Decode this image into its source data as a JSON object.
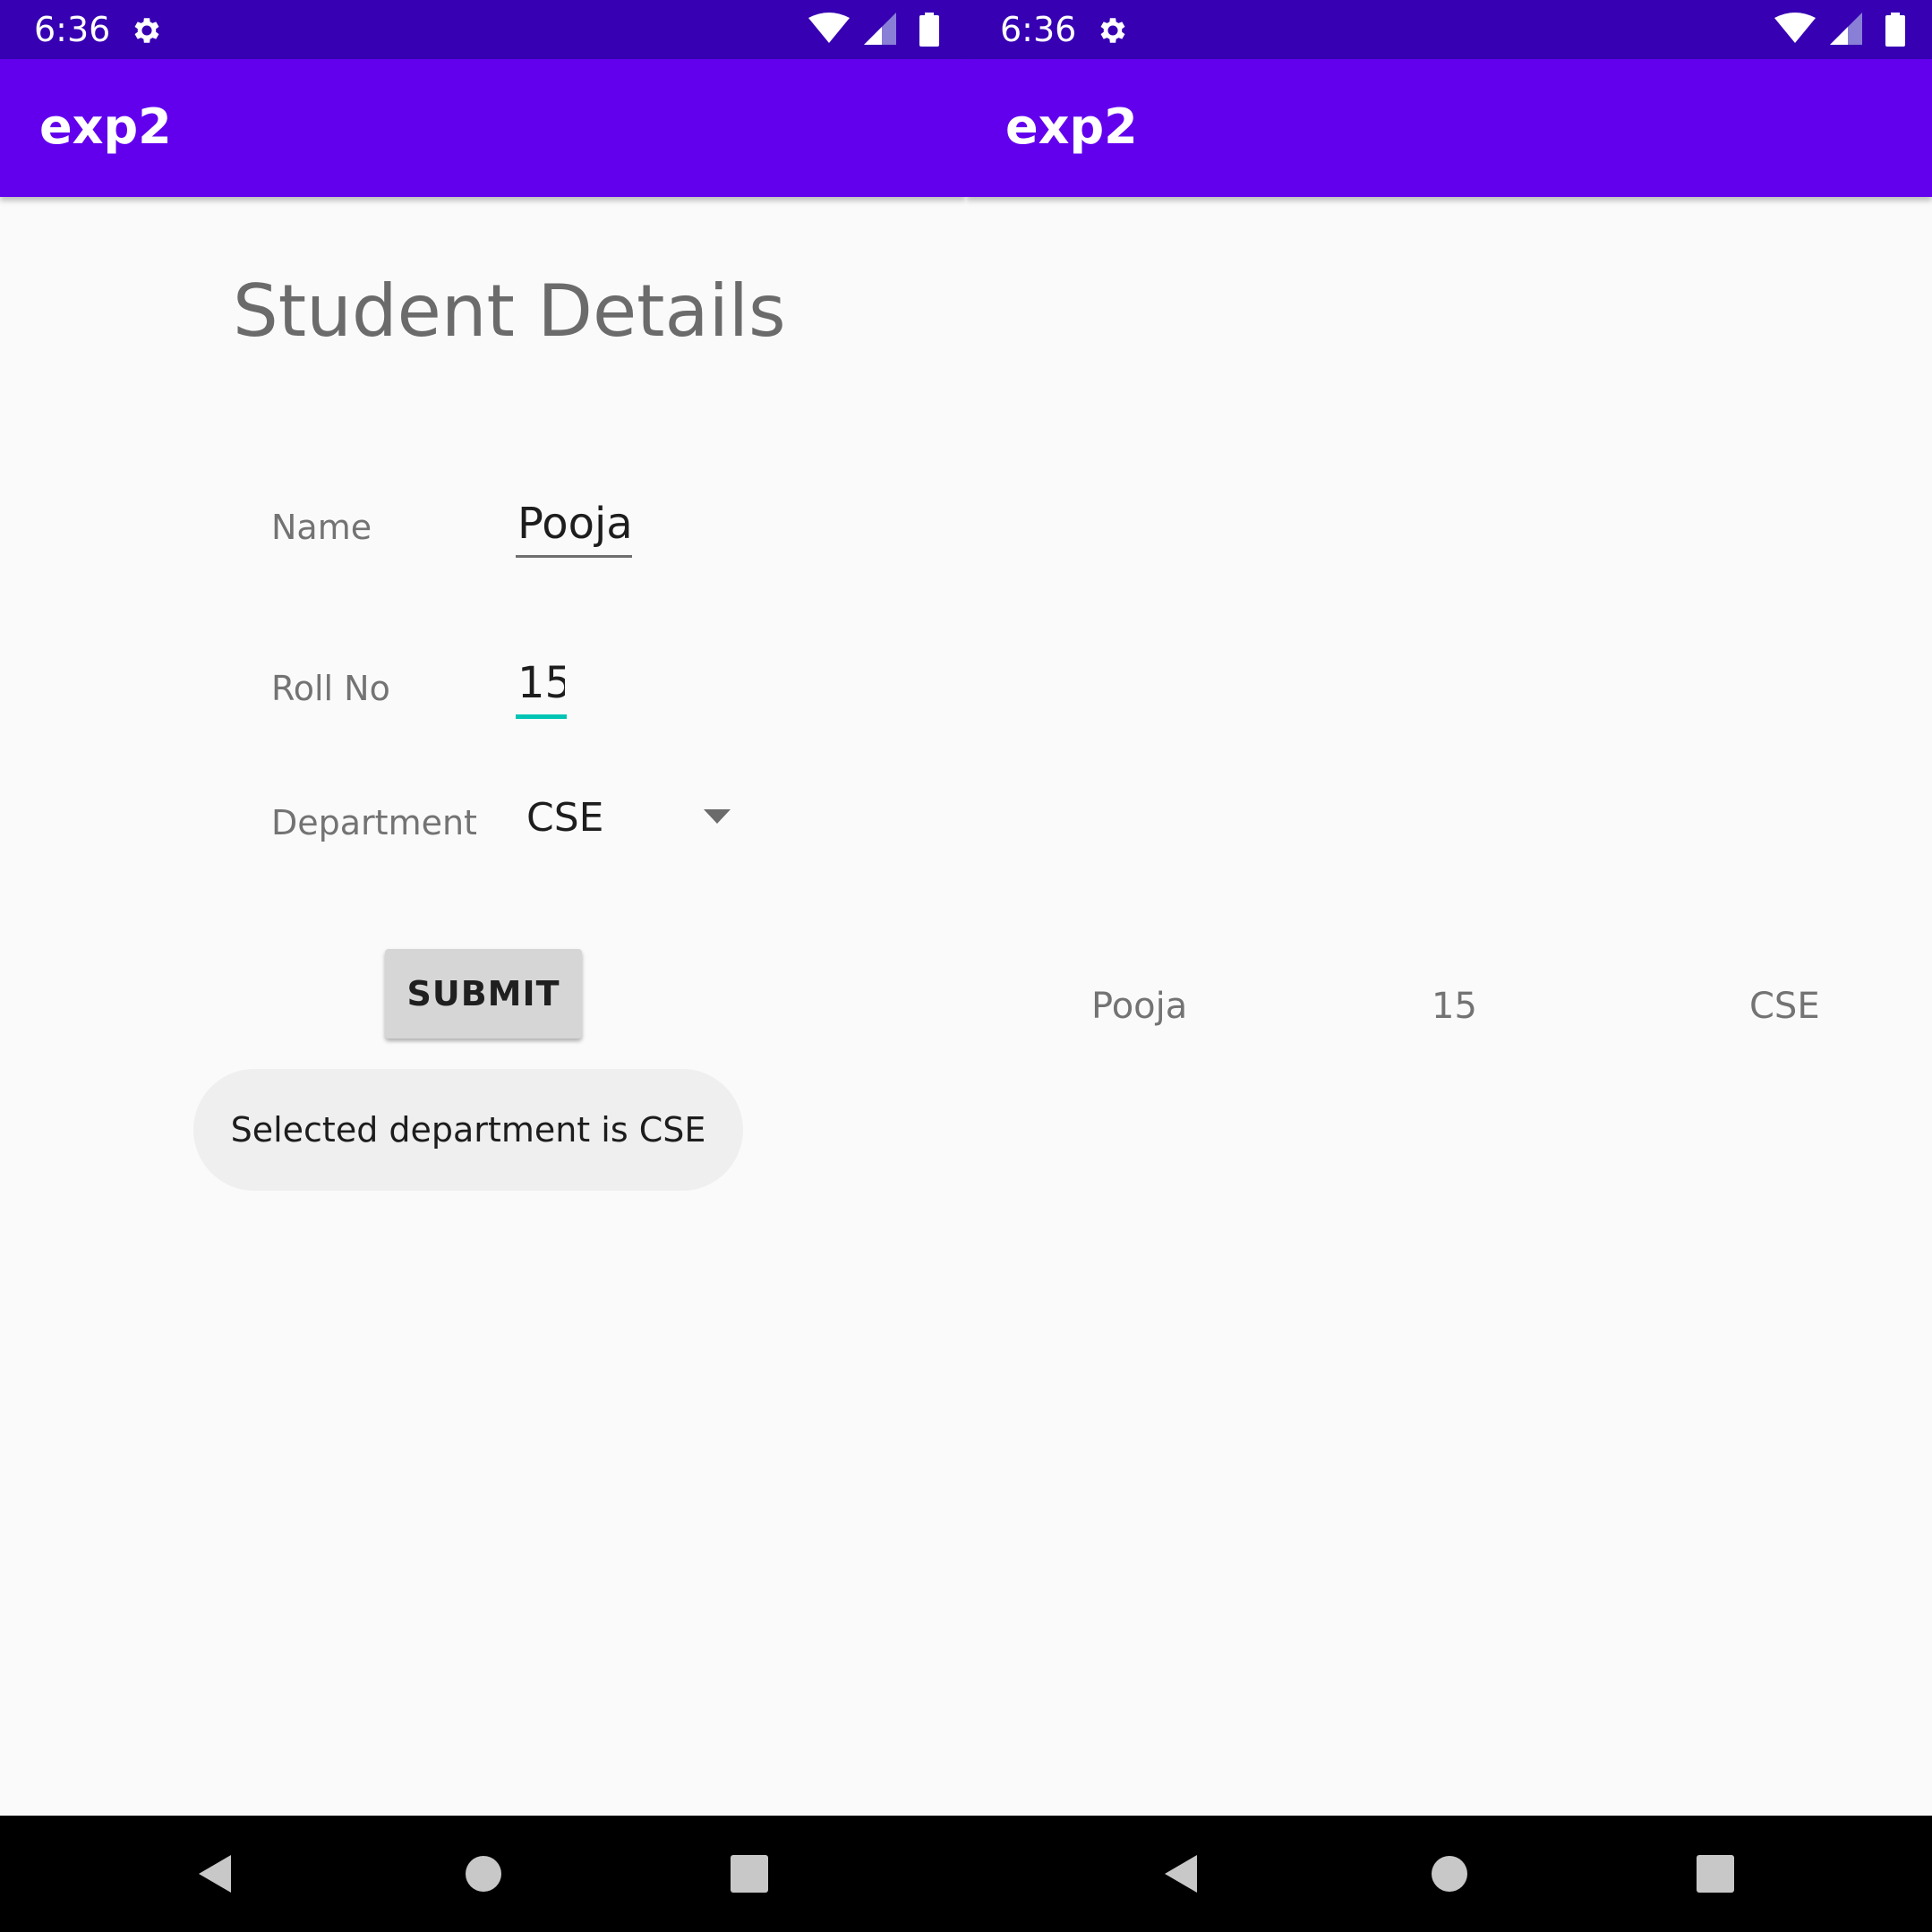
{
  "status_bar": {
    "time": "6:36",
    "background": "#3700b3"
  },
  "app_bar": {
    "title": "exp2",
    "background": "#6200ee"
  },
  "form_screen": {
    "heading": "Student Details",
    "fields": {
      "name": {
        "label": "Name",
        "value": "Pooja"
      },
      "roll_no": {
        "label": "Roll No",
        "value": "15"
      },
      "department": {
        "label": "Department",
        "selected": "CSE"
      }
    },
    "submit_label": "SUBMIT",
    "toast": "Selected department is CSE",
    "accent_color": "#00c4b4"
  },
  "result_screen": {
    "name": "Pooja",
    "roll_no": "15",
    "department": "CSE"
  },
  "nav_bar": {
    "icons": [
      "back-icon",
      "home-icon",
      "recents-icon"
    ]
  }
}
